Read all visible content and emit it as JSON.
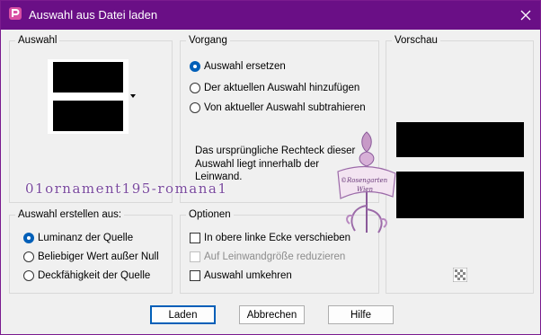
{
  "window": {
    "title": "Auswahl aus Datei laden"
  },
  "groups": {
    "selection": {
      "title": "Auswahl"
    },
    "operation": {
      "title": "Vorgang",
      "options": [
        {
          "label": "Auswahl ersetzen",
          "selected": true
        },
        {
          "label": "Der aktuellen Auswahl hinzufügen",
          "selected": false
        },
        {
          "label": "Von aktueller Auswahl subtrahieren",
          "selected": false
        }
      ],
      "info": "Das ursprüngliche Rechteck dieser Auswahl liegt innerhalb der Leinwand."
    },
    "preview": {
      "title": "Vorschau"
    },
    "create_from": {
      "title": "Auswahl erstellen aus:",
      "options": [
        {
          "label": "Luminanz der Quelle",
          "selected": true
        },
        {
          "label": "Beliebiger Wert außer Null",
          "selected": false
        },
        {
          "label": "Deckfähigkeit der Quelle",
          "selected": false
        }
      ]
    },
    "options": {
      "title": "Optionen",
      "checks": [
        {
          "label": "In obere linke Ecke verschieben",
          "checked": false,
          "enabled": true
        },
        {
          "label": "Auf Leinwandgröße reduzieren",
          "checked": false,
          "enabled": false
        },
        {
          "label": "Auswahl umkehren",
          "checked": false,
          "enabled": true
        }
      ]
    }
  },
  "buttons": {
    "load": "Laden",
    "cancel": "Abbrechen",
    "help": "Hilfe"
  },
  "overlay": {
    "filename_text": "01ornament195-romana1",
    "stamp_line1": "©Rosengarten",
    "stamp_line2": "Wien"
  },
  "colors": {
    "titlebar": "#6a0f86",
    "accent": "#005fb8",
    "watermark": "#7a4a9e"
  }
}
